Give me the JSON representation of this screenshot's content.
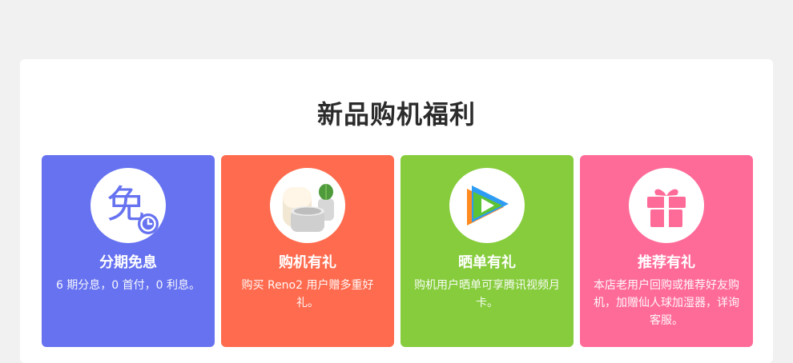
{
  "section": {
    "title": "新品购机福利"
  },
  "cards": [
    {
      "title": "分期免息",
      "description": "6 期分息，0 首付，0 利息。",
      "color": "#6672f0",
      "icon": "mian-interest-free-icon",
      "icon_glyph": "免"
    },
    {
      "title": "购机有礼",
      "description": "购买 Reno2 用户赠多重好礼。",
      "color": "#ff6b4e",
      "icon": "gift-products-icon"
    },
    {
      "title": "晒单有礼",
      "description": "购机用户晒单可享腾讯视频月卡。",
      "color": "#86cc3c",
      "icon": "tencent-video-play-icon"
    },
    {
      "title": "推荐有礼",
      "description": "本店老用户回购或推荐好友购机，加赠仙人球加湿器，详询客服。",
      "color": "#ff6b99",
      "icon": "gift-box-icon"
    }
  ]
}
